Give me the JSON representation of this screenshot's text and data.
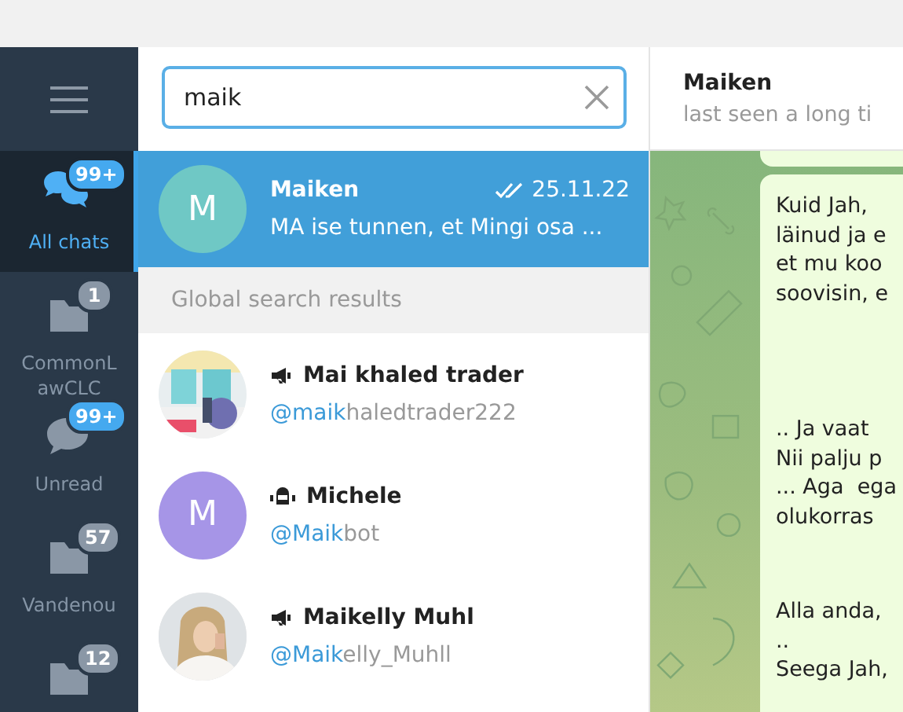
{
  "sidebar": {
    "folders": [
      {
        "kind": "chats",
        "label": "All chats",
        "badge": "99+",
        "badge_muted": false,
        "selected": true
      },
      {
        "kind": "folder",
        "label": "CommonLawCLC",
        "badge": "1",
        "badge_muted": true,
        "selected": false
      },
      {
        "kind": "unread",
        "label": "Unread",
        "badge": "99+",
        "badge_muted": false,
        "selected": false
      },
      {
        "kind": "folder",
        "label": "Vandenou",
        "badge": "57",
        "badge_muted": true,
        "selected": false
      },
      {
        "kind": "folder",
        "badge": "12",
        "badge_muted": true,
        "selected": false
      }
    ]
  },
  "search": {
    "value": "maik"
  },
  "chats": [
    {
      "initial": "M",
      "color": "#6fc8c5",
      "name": "Maiken",
      "read": true,
      "date": "25.11.22",
      "preview": "MA ise tunnen, et Mingi osa ...",
      "selected": true
    }
  ],
  "global_header": "Global search results",
  "results": [
    {
      "kind": "channel",
      "name": "Mai khaled trader",
      "handle_match": "@maik",
      "handle_rest": "haledtrader222"
    },
    {
      "kind": "bot",
      "avatar": {
        "kind": "initial",
        "initial": "M",
        "color": "#a695e7"
      },
      "name": "Michele",
      "handle_match": "@Maik",
      "handle_rest": "bot"
    },
    {
      "kind": "channel",
      "name": "Maikelly Muhl",
      "handle_match": "@Maik",
      "handle_rest": "elly_Muhll"
    }
  ],
  "chat": {
    "name": "Maiken",
    "status": "last seen a long ti",
    "message": {
      "paragraphs": [
        [
          "Kuid Jah,",
          "läinud ja e",
          "et mu koo",
          "soovisin, e"
        ],
        [
          ".. Ja vaat",
          "Nii palju p",
          "... Aga  ega",
          "olukorras"
        ],
        [
          "Alla anda,",
          "..",
          "Seega Jah,"
        ]
      ]
    }
  }
}
